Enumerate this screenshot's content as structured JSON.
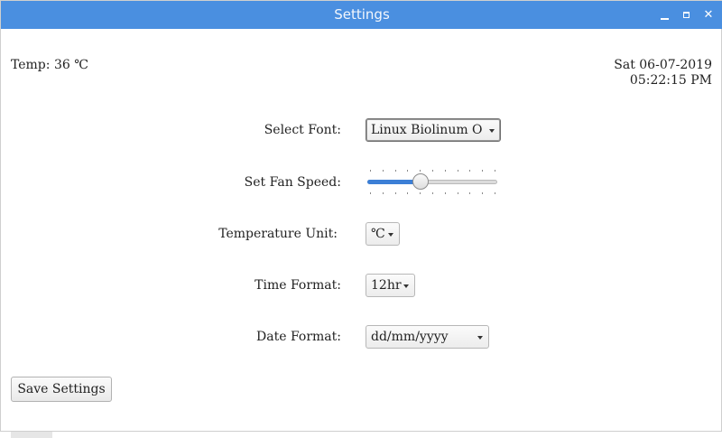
{
  "window": {
    "title": "Settings",
    "minimize_icon": "minimize-icon",
    "maximize_icon": "maximize-icon",
    "close_icon": "close-icon",
    "close_glyph": "✕",
    "titlebar_color": "#4a8fe0"
  },
  "status": {
    "temperature": "Temp: 36 ℃",
    "date": "Sat 06-07-2019",
    "time": "05:22:15 PM"
  },
  "settings": {
    "font": {
      "label": "Select Font:",
      "value": "Linux Biolinum O"
    },
    "fan_speed": {
      "label": "Set Fan Speed:",
      "level_fraction": 0.41,
      "accent": "#3c7fd6"
    },
    "temperature_unit": {
      "label": "Temperature Unit:",
      "value": "℃"
    },
    "time_format": {
      "label": "Time Format:",
      "value": "12hr"
    },
    "date_format": {
      "label": "Date Format:",
      "value": "dd/mm/yyyy"
    }
  },
  "actions": {
    "save_label": "Save Settings"
  }
}
